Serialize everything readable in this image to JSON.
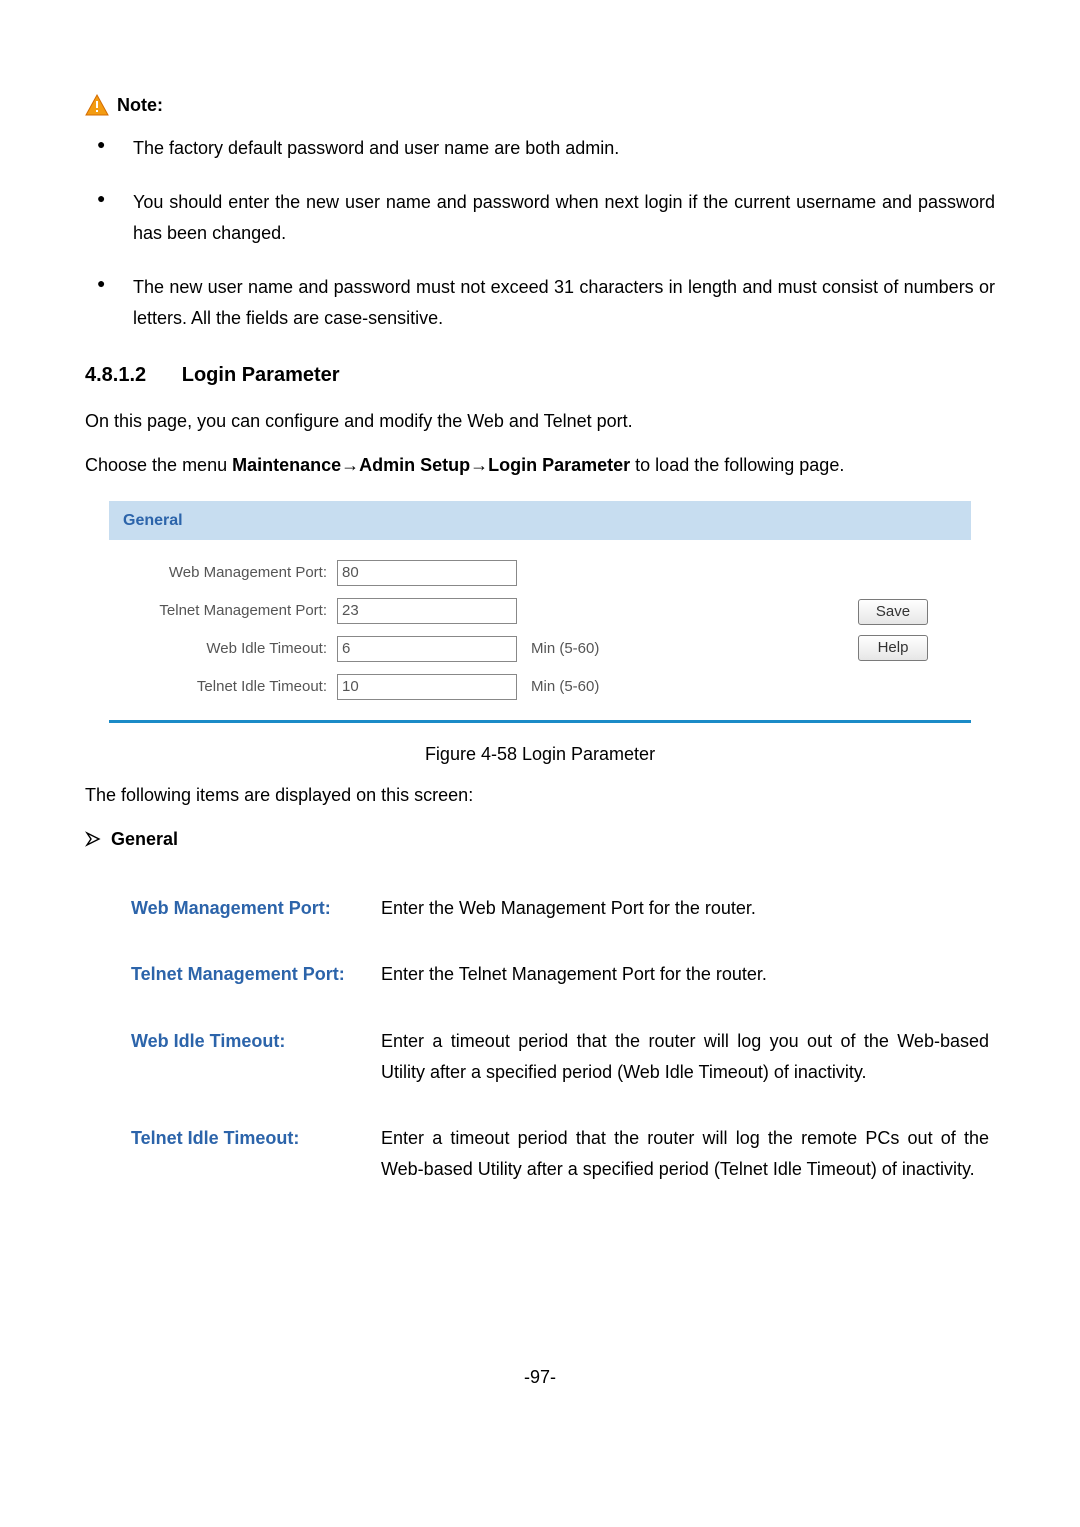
{
  "note": {
    "label": "Note:",
    "items": [
      "The factory default password and user name are both admin.",
      "You should enter the new user name and password when next login if the current username and password has been changed.",
      "The new user name and password must not exceed 31 characters in length and must consist of numbers or letters. All the fields are case-sensitive."
    ]
  },
  "section": {
    "number": "4.8.1.2",
    "title": "Login Parameter",
    "intro": "On this page, you can configure and modify the Web and Telnet port.",
    "path_prefix": "Choose the menu ",
    "path_bold": "Maintenance→Admin Setup→Login Parameter",
    "path_suffix": " to load the following page."
  },
  "panel": {
    "header": "General",
    "fields": {
      "web_port": {
        "label": "Web Management Port:",
        "value": "80",
        "suffix": ""
      },
      "telnet_port": {
        "label": "Telnet Management Port:",
        "value": "23",
        "suffix": ""
      },
      "web_idle": {
        "label": "Web Idle Timeout:",
        "value": "6",
        "suffix": "Min (5-60)"
      },
      "telnet_idle": {
        "label": "Telnet Idle Timeout:",
        "value": "10",
        "suffix": "Min (5-60)"
      }
    },
    "buttons": {
      "save": "Save",
      "help": "Help"
    }
  },
  "figure_caption": "Figure 4-58 Login Parameter",
  "items_displayed": "The following items are displayed on this screen:",
  "general_label": "General",
  "defs": [
    {
      "term": "Web Management Port:",
      "desc": "Enter the Web Management Port for the router."
    },
    {
      "term": "Telnet Management Port:",
      "desc": "Enter the Telnet Management Port for the router."
    },
    {
      "term": "Web Idle Timeout:",
      "desc": "Enter a timeout period that the router will log you out of the Web-based Utility after a specified period (Web Idle Timeout) of inactivity."
    },
    {
      "term": "Telnet Idle Timeout:",
      "desc": "Enter a timeout period that the router will log the remote PCs out of the Web-based Utility after a specified period (Telnet Idle Timeout) of inactivity."
    }
  ],
  "page_number": "-97-"
}
